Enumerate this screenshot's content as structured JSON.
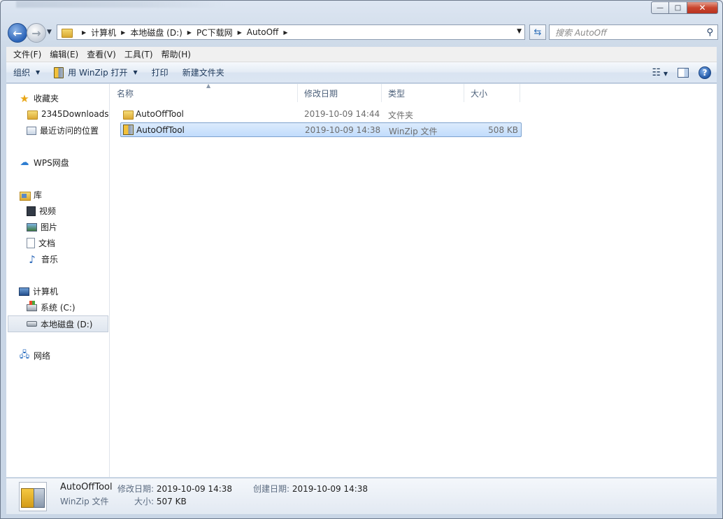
{
  "window": {
    "controls": {
      "minimize": "—",
      "maximize": "□",
      "close": "✕"
    }
  },
  "nav": {
    "breadcrumbs": [
      "计算机",
      "本地磁盘 (D:)",
      "PC下载网",
      "AutoOff"
    ],
    "search_placeholder": "搜索 AutoOff"
  },
  "menubar": {
    "items": [
      "文件(F)",
      "编辑(E)",
      "查看(V)",
      "工具(T)",
      "帮助(H)"
    ]
  },
  "toolbar": {
    "organize": "组织",
    "open_with": "用 WinZip 打开",
    "print": "打印",
    "new_folder": "新建文件夹"
  },
  "sidebar": {
    "favorites": "收藏夹",
    "downloads": "2345Downloads",
    "recent": "最近访问的位置",
    "wps": "WPS网盘",
    "libraries": "库",
    "videos": "视频",
    "pictures": "图片",
    "documents": "文档",
    "music": "音乐",
    "computer": "计算机",
    "drive_c": "系统 (C:)",
    "drive_d": "本地磁盘 (D:)",
    "network": "网络"
  },
  "columns": {
    "name": "名称",
    "modified": "修改日期",
    "type": "类型",
    "size": "大小"
  },
  "files": [
    {
      "name": "AutoOffTool",
      "modified": "2019-10-09 14:44",
      "type": "文件夹",
      "size": "",
      "icon": "folder-icon"
    },
    {
      "name": "AutoOffTool",
      "modified": "2019-10-09 14:38",
      "type": "WinZip 文件",
      "size": "508 KB",
      "icon": "winzip-icon"
    }
  ],
  "details": {
    "name": "AutoOffTool",
    "modified_label": "修改日期:",
    "modified": "2019-10-09 14:38",
    "created_label": "创建日期:",
    "created": "2019-10-09 14:38",
    "type": "WinZip 文件",
    "size_label": "大小:",
    "size": "507 KB"
  }
}
